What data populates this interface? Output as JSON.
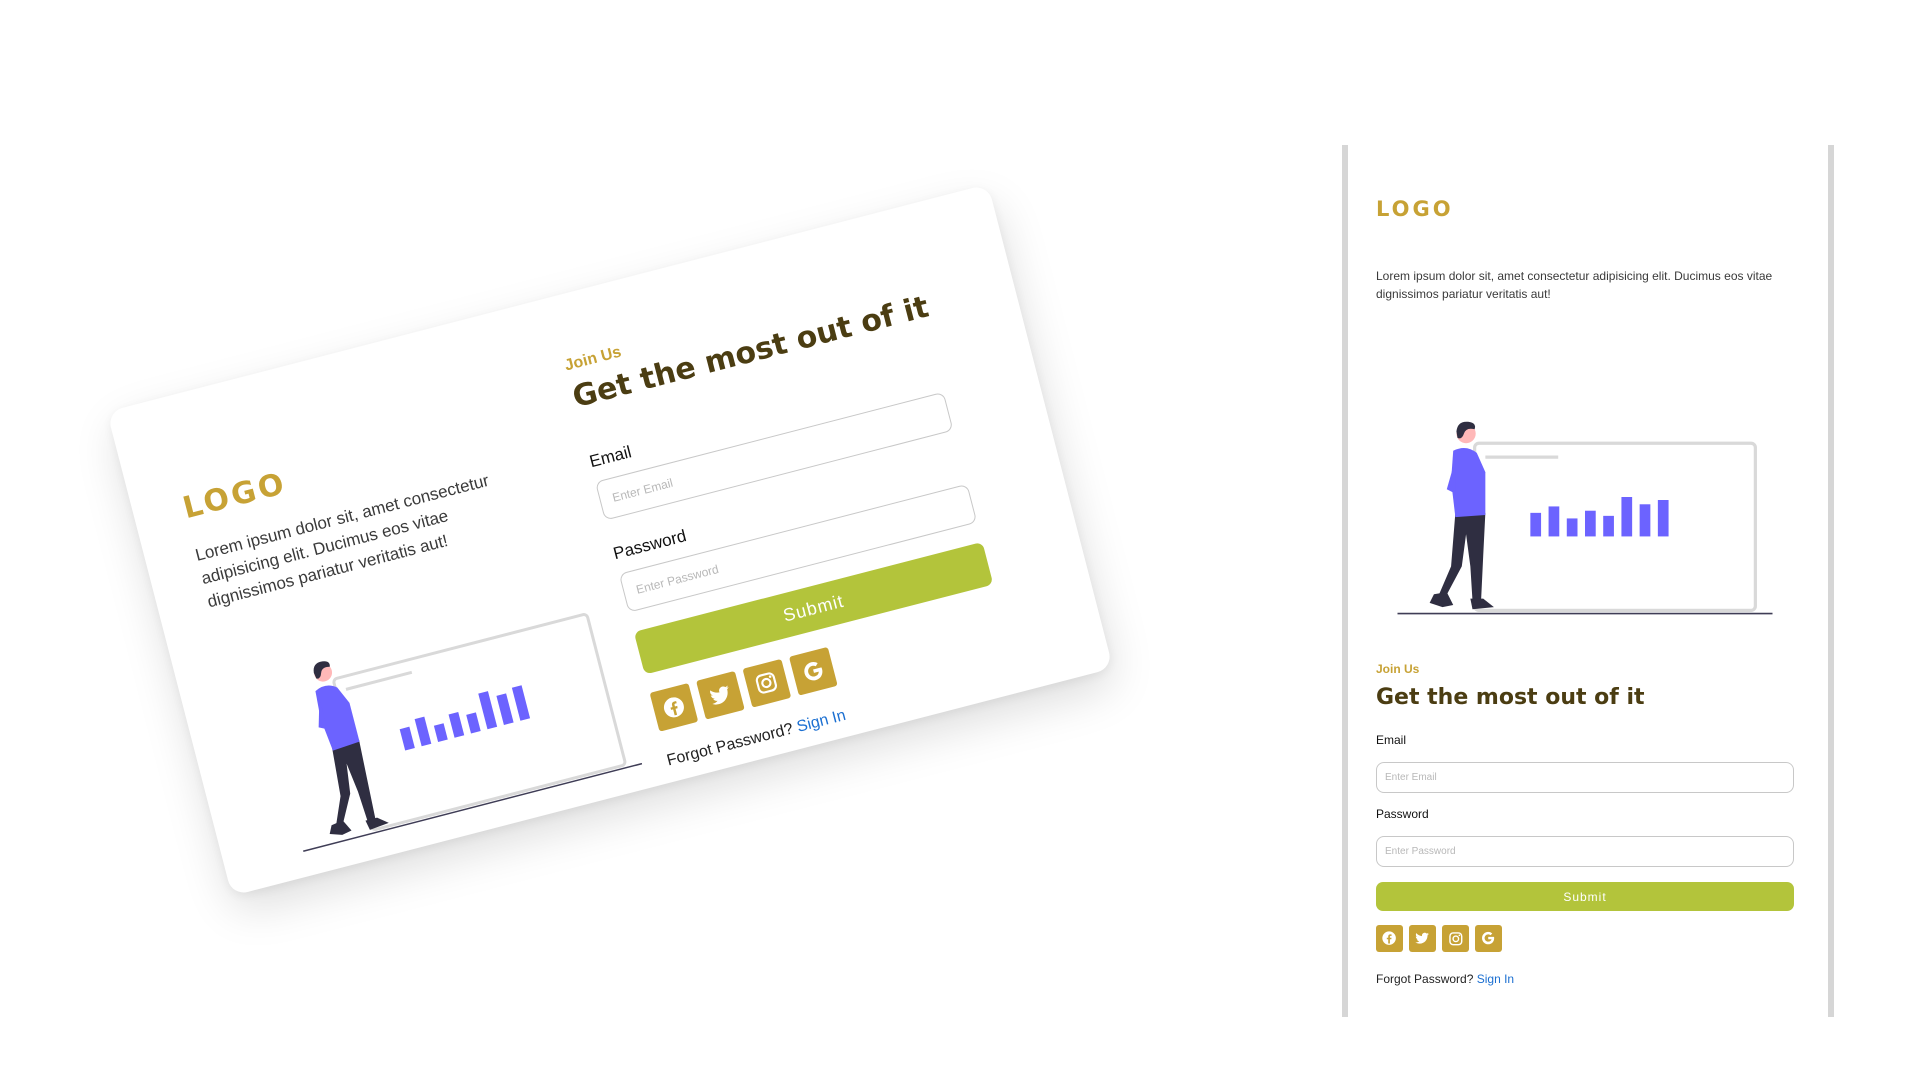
{
  "brand": {
    "logo": "LOGO",
    "description": "Lorem ipsum dolor sit, amet consectetur adipisicing elit. Ducimus eos vitae dignissimos pariatur veritatis aut!"
  },
  "form": {
    "eyebrow": "Join Us",
    "headline": "Get the most out of it",
    "email_label": "Email",
    "email_placeholder": "Enter Email",
    "password_label": "Password",
    "password_placeholder": "Enter Password",
    "submit_label": "Submit",
    "forgot_text": "Forgot Password?",
    "signin_link": "Sign In"
  },
  "social": {
    "icons": [
      "facebook-icon",
      "twitter-icon",
      "instagram-icon",
      "google-icon"
    ]
  },
  "illustration": {
    "chart_bars": [
      0.55,
      0.7,
      0.42,
      0.6,
      0.48,
      0.92,
      0.75,
      0.85
    ]
  },
  "colors": {
    "accent_gold": "#c7a235",
    "headline_brown": "#4b3d12",
    "submit_green": "#b3c43b",
    "link_blue": "#1b6fd1",
    "illustration_purple": "#6c63ff",
    "page_background": "#ffffff"
  }
}
